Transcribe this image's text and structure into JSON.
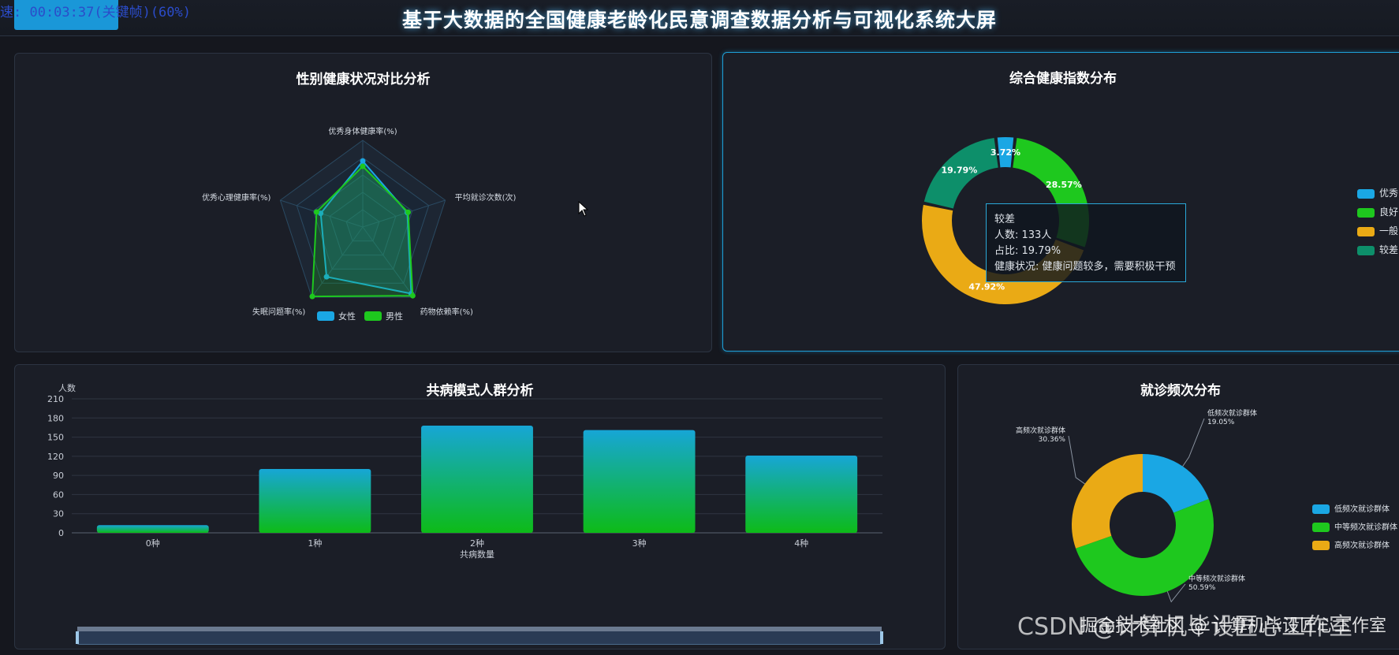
{
  "header": {
    "title": "基于大数据的全国健康老龄化民意调查数据分析与可视化系统大屏",
    "overlay_text": "速: 00:03:37(关键帧)(60%)"
  },
  "radar": {
    "title": "性别健康状况对比分析",
    "indicators": [
      "优秀身体健康率(%)",
      "平均就诊次数(次)",
      "药物依赖率(%)",
      "失眠问题率(%)",
      "优秀心理健康率(%)"
    ],
    "legend": [
      {
        "name": "女性",
        "color": "#1aa7e4"
      },
      {
        "name": "男性",
        "color": "#1ec81e"
      }
    ]
  },
  "health_index": {
    "title": "综合健康指数分布",
    "labels": [
      "3.72%",
      "28.57%",
      "47.92%",
      "19.79%"
    ],
    "legend": [
      {
        "name": "优秀",
        "color": "#1aa7e4"
      },
      {
        "name": "良好",
        "color": "#1ec81e"
      },
      {
        "name": "一般",
        "color": "#eaaa15"
      },
      {
        "name": "较差",
        "color": "#0d8f6a"
      }
    ],
    "tooltip": {
      "title": "较差",
      "count": "人数: 133人",
      "ratio": "占比: 19.79%",
      "status": "健康状况: 健康问题较多，需要积极干预"
    }
  },
  "comorbidity": {
    "title": "共病模式人群分析",
    "ylabel": "人数",
    "xlabel": "共病数量",
    "yticks": [
      "0",
      "30",
      "60",
      "90",
      "120",
      "150",
      "180",
      "210"
    ]
  },
  "visit_freq": {
    "title": "就诊频次分布",
    "slices": [
      {
        "name": "低频次就诊群体",
        "pct": "19.05%",
        "color": "#1aa7e4"
      },
      {
        "name": "中等频次就诊群体",
        "pct": "50.59%",
        "color": "#1ec81e"
      },
      {
        "name": "高频次就诊群体",
        "pct": "30.36%",
        "color": "#eaaa15"
      }
    ]
  },
  "watermark": {
    "text": "CSDN @计算机毕设匠心工作室",
    "text2": "掘金技术社区 @ 计算机毕设匠心工作室"
  },
  "chart_data": [
    {
      "type": "radar",
      "title": "性别健康状况对比分析",
      "indicators": [
        "优秀身体健康率(%)",
        "平均就诊次数(次)",
        "药物依赖率(%)",
        "失眠问题率(%)",
        "优秀心理健康率(%)"
      ],
      "series": [
        {
          "name": "女性",
          "values": [
            0.76,
            0.54,
            0.95,
            0.71,
            0.51
          ]
        },
        {
          "name": "男性",
          "values": [
            0.7,
            0.55,
            0.98,
            0.99,
            0.56
          ]
        }
      ]
    },
    {
      "type": "pie",
      "title": "综合健康指数分布",
      "categories": [
        "优秀",
        "良好",
        "一般",
        "较差"
      ],
      "values": [
        3.72,
        28.57,
        47.92,
        19.79
      ]
    },
    {
      "type": "bar",
      "title": "共病模式人群分析",
      "categories": [
        "0种",
        "1种",
        "2种",
        "3种",
        "4种"
      ],
      "values": [
        12,
        100,
        168,
        161,
        121
      ],
      "xlabel": "共病数量",
      "ylabel": "人数",
      "ylim": [
        0,
        210
      ]
    },
    {
      "type": "pie",
      "title": "就诊频次分布",
      "categories": [
        "低频次就诊群体",
        "中等频次就诊群体",
        "高频次就诊群体"
      ],
      "values": [
        19.05,
        50.59,
        30.36
      ]
    }
  ]
}
